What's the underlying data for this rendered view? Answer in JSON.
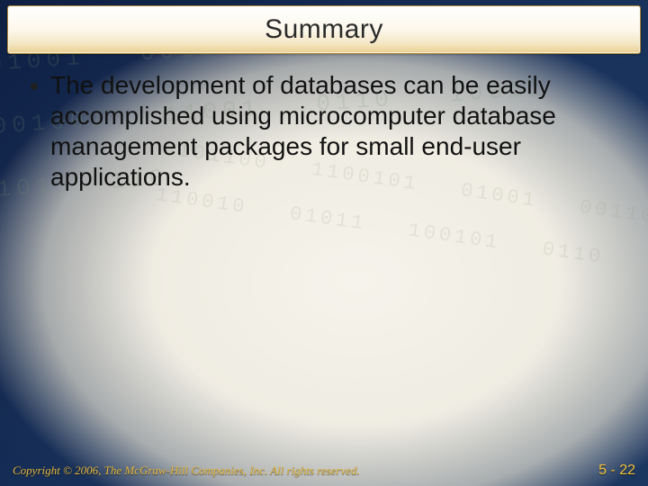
{
  "header": {
    "title": "Summary"
  },
  "body": {
    "bullets": [
      {
        "text": "The development of databases can be easily accomplished using microcomputer database management packages for small end-user applications."
      }
    ]
  },
  "footer": {
    "copyright": "Copyright © 2006, The McGraw-Hill Companies, Inc. All rights reserved.",
    "page": "5 - 22"
  }
}
